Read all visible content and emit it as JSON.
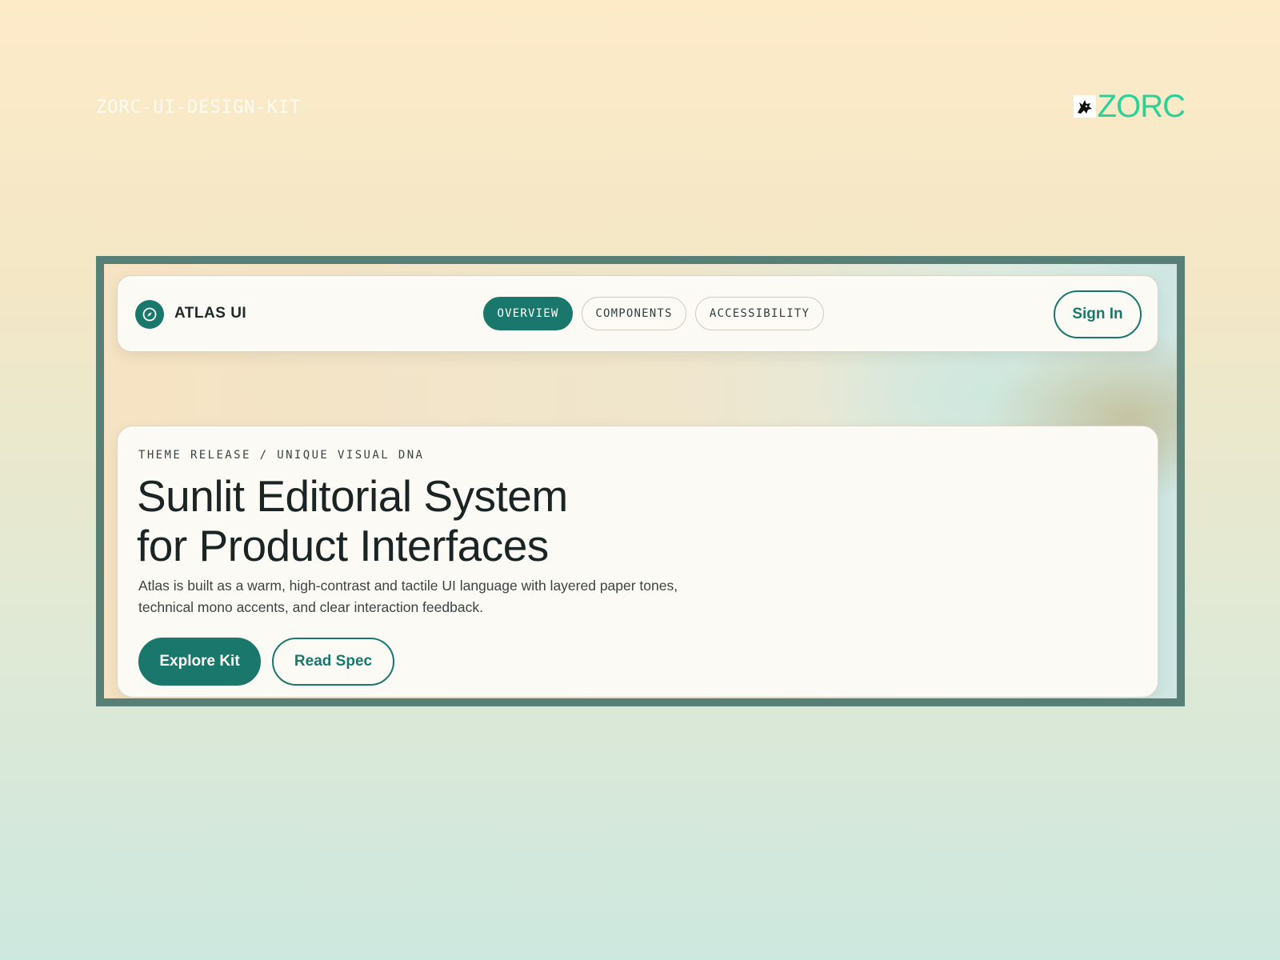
{
  "kit_label": "ZORC-UI-DESIGN-KIT",
  "brand": {
    "text": "ZORC",
    "icon": "wolf-head-icon",
    "color": "#2ad29a"
  },
  "navbar": {
    "logo_icon": "compass-icon",
    "app_name": "ATLAS UI",
    "tabs": [
      {
        "label": "OVERVIEW",
        "active": true
      },
      {
        "label": "COMPONENTS",
        "active": false
      },
      {
        "label": "ACCESSIBILITY",
        "active": false
      }
    ],
    "sign_in": "Sign In"
  },
  "hero": {
    "eyebrow": "THEME RELEASE / UNIQUE VISUAL DNA",
    "headline_line1": "Sunlit Editorial System",
    "headline_line2": "for Product Interfaces",
    "description_line1": "Atlas is built as a warm, high-contrast and tactile UI language with layered paper tones,",
    "description_line2": "technical mono accents, and clear interaction feedback.",
    "primary_cta": "Explore Kit",
    "secondary_cta": "Read Spec"
  },
  "colors": {
    "accent": "#19776b",
    "frame_border": "#587f75",
    "paper": "#fcfaf4",
    "text_dark": "#1a2424"
  }
}
